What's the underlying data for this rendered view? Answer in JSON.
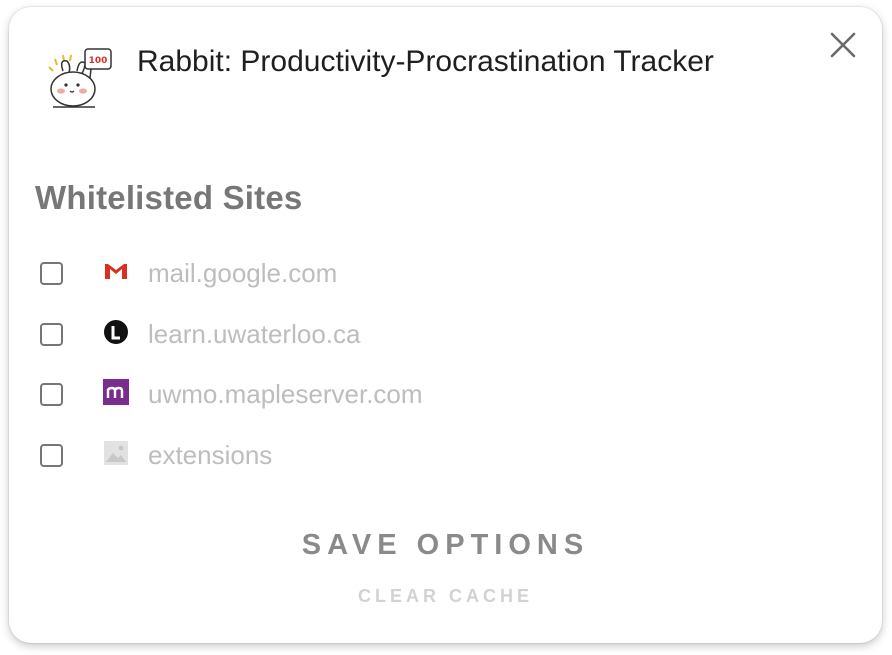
{
  "app": {
    "title": "Rabbit: Productivity-Procrastination Tracker",
    "logo_badge": "100"
  },
  "close": {
    "icon": "close-icon"
  },
  "whitelist": {
    "title": "Whitelisted Sites",
    "sites": [
      {
        "label": "mail.google.com",
        "icon": "gmail-icon",
        "checked": false
      },
      {
        "label": "learn.uwaterloo.ca",
        "icon": "learn-icon",
        "checked": false
      },
      {
        "label": "uwmo.mapleserver.com",
        "icon": "maple-icon",
        "checked": false
      },
      {
        "label": "extensions",
        "icon": "extensions-icon",
        "checked": false
      }
    ]
  },
  "actions": {
    "save_label": "SAVE OPTIONS",
    "clear_label": "CLEAR CACHE"
  },
  "colors": {
    "title_text": "#1f1f1f",
    "section_title": "#777777",
    "site_text": "#bdbdbd",
    "save_text": "#8a8a8a",
    "clear_text": "#d2d2d2",
    "gmail_red": "#d93025",
    "maple_purple": "#7b2c8f"
  }
}
